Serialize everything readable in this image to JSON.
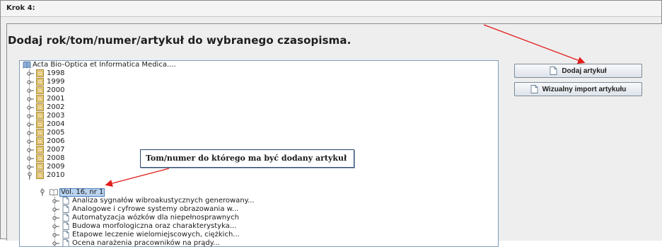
{
  "step": {
    "label": "Krok 4:"
  },
  "heading": "Dodaj rok/tom/numer/artykuł do wybranego czasopisma.",
  "tree": {
    "root": "Acta Bio-Optica et Informatica Medica....",
    "years": [
      "1998",
      "1999",
      "2000",
      "2001",
      "2002",
      "2003",
      "2004",
      "2005",
      "2006",
      "2007",
      "2008",
      "2009",
      "2010"
    ],
    "volume": "Vol. 16, nr 1",
    "articles": [
      "Analiza sygnałów wibroakustycznych generowany...",
      "Analogowe i cyfrowe systemy obrazowania w...",
      "Automatyzacja wózków dla niepełnosprawnych",
      "Budowa morfologiczna oraz charakterystyka...",
      "Etapowe leczenie wielomiejscowych, ciężkich...",
      "Ocena narażenia pracowników na prądy..."
    ]
  },
  "buttons": {
    "add_article": "Dodaj artykuł",
    "visual_import": "Wizualny import artykułu"
  },
  "callout": {
    "text": "Tom/numer do którego ma być dodany artykuł"
  },
  "colors": {
    "arrow": "#e31b1b",
    "selection": "#b9d2ee",
    "tree_border": "#7f9db9"
  }
}
